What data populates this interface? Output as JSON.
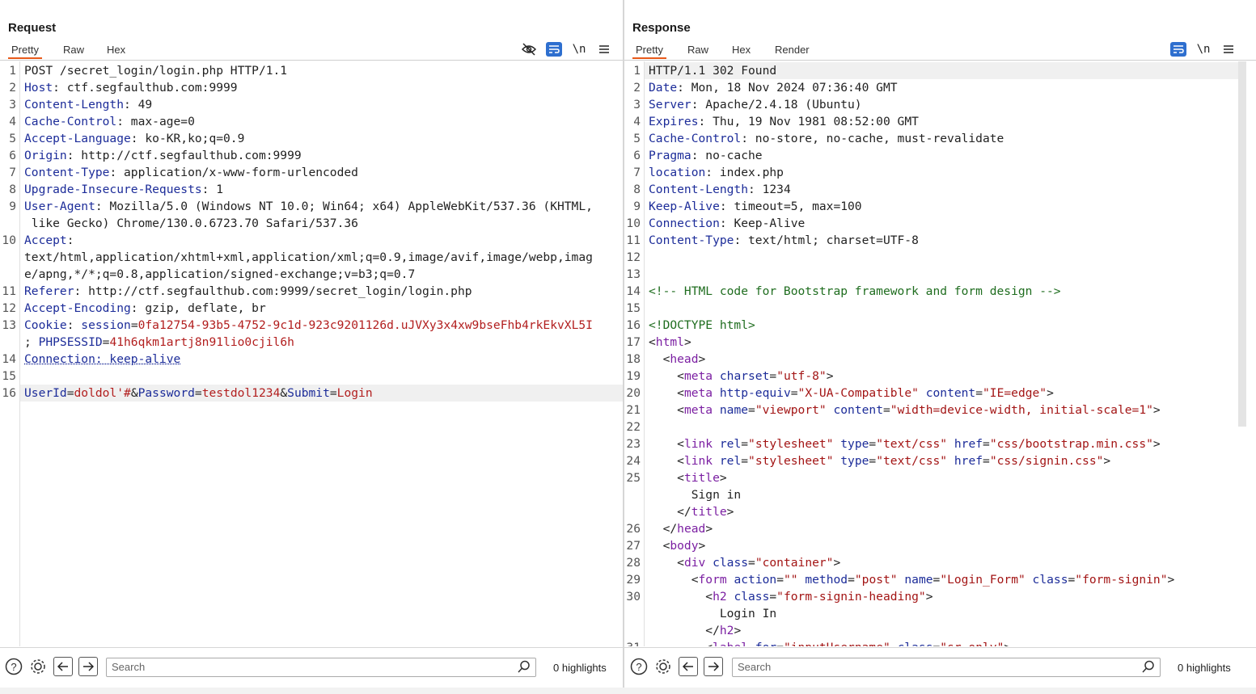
{
  "request": {
    "title": "Request",
    "tabs": [
      "Pretty",
      "Raw",
      "Hex"
    ],
    "active_tab": "Pretty",
    "lines": [
      {
        "n": "1",
        "parts": [
          {
            "t": "POST /secret_login/login.php HTTP/1.1",
            "c": "v"
          }
        ]
      },
      {
        "n": "2",
        "parts": [
          {
            "t": "Host",
            "c": "k"
          },
          {
            "t": ": ctf.segfaulthub.com:9999",
            "c": "v"
          }
        ]
      },
      {
        "n": "3",
        "parts": [
          {
            "t": "Content-Length",
            "c": "k"
          },
          {
            "t": ": 49",
            "c": "v"
          }
        ]
      },
      {
        "n": "4",
        "parts": [
          {
            "t": "Cache-Control",
            "c": "k"
          },
          {
            "t": ": max-age=0",
            "c": "v"
          }
        ]
      },
      {
        "n": "5",
        "parts": [
          {
            "t": "Accept-Language",
            "c": "k"
          },
          {
            "t": ": ko-KR,ko;q=0.9",
            "c": "v"
          }
        ]
      },
      {
        "n": "6",
        "parts": [
          {
            "t": "Origin",
            "c": "k"
          },
          {
            "t": ": http://ctf.segfaulthub.com:9999",
            "c": "v"
          }
        ]
      },
      {
        "n": "7",
        "parts": [
          {
            "t": "Content-Type",
            "c": "k"
          },
          {
            "t": ": application/x-www-form-urlencoded",
            "c": "v"
          }
        ]
      },
      {
        "n": "8",
        "parts": [
          {
            "t": "Upgrade-Insecure-Requests",
            "c": "k"
          },
          {
            "t": ": 1",
            "c": "v"
          }
        ]
      },
      {
        "n": "9",
        "parts": [
          {
            "t": "User-Agent",
            "c": "k"
          },
          {
            "t": ": Mozilla/5.0 (Windows NT 10.0; Win64; x64) AppleWebKit/537.36 (KHTML,",
            "c": "v"
          }
        ]
      },
      {
        "n": "",
        "parts": [
          {
            "t": " like Gecko) Chrome/130.0.6723.70 Safari/537.36",
            "c": "v"
          }
        ]
      },
      {
        "n": "10",
        "parts": [
          {
            "t": "Accept",
            "c": "k"
          },
          {
            "t": ":",
            "c": "v"
          }
        ]
      },
      {
        "n": "",
        "parts": [
          {
            "t": "text/html,application/xhtml+xml,application/xml;q=0.9,image/avif,image/webp,imag",
            "c": "v"
          }
        ]
      },
      {
        "n": "",
        "parts": [
          {
            "t": "e/apng,*/*;q=0.8,application/signed-exchange;v=b3;q=0.7",
            "c": "v"
          }
        ]
      },
      {
        "n": "11",
        "parts": [
          {
            "t": "Referer",
            "c": "k"
          },
          {
            "t": ": http://ctf.segfaulthub.com:9999/secret_login/login.php",
            "c": "v"
          }
        ]
      },
      {
        "n": "12",
        "parts": [
          {
            "t": "Accept-Encoding",
            "c": "k"
          },
          {
            "t": ": gzip, deflate, br",
            "c": "v"
          }
        ]
      },
      {
        "n": "13",
        "parts": [
          {
            "t": "Cookie",
            "c": "k"
          },
          {
            "t": ": ",
            "c": "v"
          },
          {
            "t": "session",
            "c": "k"
          },
          {
            "t": "=",
            "c": "v"
          },
          {
            "t": "0fa12754-93b5-4752-9c1d-923c9201126d.uJVXy3x4xw9bseFhb4rkEkvXL5I",
            "c": "r"
          }
        ]
      },
      {
        "n": "",
        "parts": [
          {
            "t": "; ",
            "c": "v"
          },
          {
            "t": "PHPSESSID",
            "c": "k"
          },
          {
            "t": "=",
            "c": "v"
          },
          {
            "t": "41h6qkm1artj8n91lio0cjil6h",
            "c": "r"
          }
        ]
      },
      {
        "n": "14",
        "parts": [
          {
            "t": "Connection: keep-alive",
            "c": "k dl"
          }
        ]
      },
      {
        "n": "15",
        "parts": []
      },
      {
        "n": "16",
        "highlight": true,
        "parts": [
          {
            "t": "UserId",
            "c": "k"
          },
          {
            "t": "=",
            "c": "v"
          },
          {
            "t": "doldol'#",
            "c": "r"
          },
          {
            "t": "&",
            "c": "v"
          },
          {
            "t": "Password",
            "c": "k"
          },
          {
            "t": "=",
            "c": "v"
          },
          {
            "t": "testdol1234",
            "c": "r"
          },
          {
            "t": "&",
            "c": "v"
          },
          {
            "t": "Submit",
            "c": "k"
          },
          {
            "t": "=",
            "c": "v"
          },
          {
            "t": "Login",
            "c": "r"
          }
        ]
      }
    ],
    "search_placeholder": "Search",
    "highlights": "0 highlights"
  },
  "response": {
    "title": "Response",
    "tabs": [
      "Pretty",
      "Raw",
      "Hex",
      "Render"
    ],
    "active_tab": "Pretty",
    "lines": [
      {
        "n": "1",
        "highlight": true,
        "parts": [
          {
            "t": "HTTP/1.1 302 Found",
            "c": "v"
          }
        ]
      },
      {
        "n": "2",
        "parts": [
          {
            "t": "Date",
            "c": "k"
          },
          {
            "t": ": Mon, 18 Nov 2024 07:36:40 GMT",
            "c": "v"
          }
        ]
      },
      {
        "n": "3",
        "parts": [
          {
            "t": "Server",
            "c": "k"
          },
          {
            "t": ": Apache/2.4.18 (Ubuntu)",
            "c": "v"
          }
        ]
      },
      {
        "n": "4",
        "parts": [
          {
            "t": "Expires",
            "c": "k"
          },
          {
            "t": ": Thu, 19 Nov 1981 08:52:00 GMT",
            "c": "v"
          }
        ]
      },
      {
        "n": "5",
        "parts": [
          {
            "t": "Cache-Control",
            "c": "k"
          },
          {
            "t": ": no-store, no-cache, must-revalidate",
            "c": "v"
          }
        ]
      },
      {
        "n": "6",
        "parts": [
          {
            "t": "Pragma",
            "c": "k"
          },
          {
            "t": ": no-cache",
            "c": "v"
          }
        ]
      },
      {
        "n": "7",
        "parts": [
          {
            "t": "location",
            "c": "k"
          },
          {
            "t": ": index.php",
            "c": "v"
          }
        ]
      },
      {
        "n": "8",
        "parts": [
          {
            "t": "Content-Length",
            "c": "k"
          },
          {
            "t": ": 1234",
            "c": "v"
          }
        ]
      },
      {
        "n": "9",
        "parts": [
          {
            "t": "Keep-Alive",
            "c": "k"
          },
          {
            "t": ": timeout=5, max=100",
            "c": "v"
          }
        ]
      },
      {
        "n": "10",
        "parts": [
          {
            "t": "Connection",
            "c": "k"
          },
          {
            "t": ": Keep-Alive",
            "c": "v"
          }
        ]
      },
      {
        "n": "11",
        "parts": [
          {
            "t": "Content-Type",
            "c": "k"
          },
          {
            "t": ": text/html; charset=UTF-8",
            "c": "v"
          }
        ]
      },
      {
        "n": "12",
        "parts": []
      },
      {
        "n": "13",
        "parts": []
      },
      {
        "n": "14",
        "parts": [
          {
            "t": "<!-- HTML code for Bootstrap framework and form design -->",
            "c": "pr"
          }
        ]
      },
      {
        "n": "15",
        "parts": []
      },
      {
        "n": "16",
        "parts": [
          {
            "t": "<!DOCTYPE html>",
            "c": "pr"
          }
        ]
      },
      {
        "n": "17",
        "parts": [
          {
            "t": "<",
            "c": "v"
          },
          {
            "t": "html",
            "c": "tg"
          },
          {
            "t": ">",
            "c": "v"
          }
        ]
      },
      {
        "n": "18",
        "parts": [
          {
            "t": "  <",
            "c": "v"
          },
          {
            "t": "head",
            "c": "tg"
          },
          {
            "t": ">",
            "c": "v"
          }
        ]
      },
      {
        "n": "19",
        "parts": [
          {
            "t": "    <",
            "c": "v"
          },
          {
            "t": "meta",
            "c": "tg"
          },
          {
            "t": " charset",
            "c": "at"
          },
          {
            "t": "=",
            "c": "v"
          },
          {
            "t": "\"utf-8\"",
            "c": "st"
          },
          {
            "t": ">",
            "c": "v"
          }
        ]
      },
      {
        "n": "20",
        "parts": [
          {
            "t": "    <",
            "c": "v"
          },
          {
            "t": "meta",
            "c": "tg"
          },
          {
            "t": " http-equiv",
            "c": "at"
          },
          {
            "t": "=",
            "c": "v"
          },
          {
            "t": "\"X-UA-Compatible\"",
            "c": "st"
          },
          {
            "t": " content",
            "c": "at"
          },
          {
            "t": "=",
            "c": "v"
          },
          {
            "t": "\"IE=edge\"",
            "c": "st"
          },
          {
            "t": ">",
            "c": "v"
          }
        ]
      },
      {
        "n": "21",
        "parts": [
          {
            "t": "    <",
            "c": "v"
          },
          {
            "t": "meta",
            "c": "tg"
          },
          {
            "t": " name",
            "c": "at"
          },
          {
            "t": "=",
            "c": "v"
          },
          {
            "t": "\"viewport\"",
            "c": "st"
          },
          {
            "t": " content",
            "c": "at"
          },
          {
            "t": "=",
            "c": "v"
          },
          {
            "t": "\"width=device-width, initial-scale=1\"",
            "c": "st"
          },
          {
            "t": ">",
            "c": "v"
          }
        ]
      },
      {
        "n": "22",
        "parts": []
      },
      {
        "n": "23",
        "parts": [
          {
            "t": "    <",
            "c": "v"
          },
          {
            "t": "link",
            "c": "tg"
          },
          {
            "t": " rel",
            "c": "at"
          },
          {
            "t": "=",
            "c": "v"
          },
          {
            "t": "\"stylesheet\"",
            "c": "st"
          },
          {
            "t": " type",
            "c": "at"
          },
          {
            "t": "=",
            "c": "v"
          },
          {
            "t": "\"text/css\"",
            "c": "st"
          },
          {
            "t": " href",
            "c": "at"
          },
          {
            "t": "=",
            "c": "v"
          },
          {
            "t": "\"css/bootstrap.min.css\"",
            "c": "st"
          },
          {
            "t": ">",
            "c": "v"
          }
        ]
      },
      {
        "n": "24",
        "parts": [
          {
            "t": "    <",
            "c": "v"
          },
          {
            "t": "link",
            "c": "tg"
          },
          {
            "t": " rel",
            "c": "at"
          },
          {
            "t": "=",
            "c": "v"
          },
          {
            "t": "\"stylesheet\"",
            "c": "st"
          },
          {
            "t": " type",
            "c": "at"
          },
          {
            "t": "=",
            "c": "v"
          },
          {
            "t": "\"text/css\"",
            "c": "st"
          },
          {
            "t": " href",
            "c": "at"
          },
          {
            "t": "=",
            "c": "v"
          },
          {
            "t": "\"css/signin.css\"",
            "c": "st"
          },
          {
            "t": ">",
            "c": "v"
          }
        ]
      },
      {
        "n": "25",
        "parts": [
          {
            "t": "    <",
            "c": "v"
          },
          {
            "t": "title",
            "c": "tg"
          },
          {
            "t": ">",
            "c": "v"
          }
        ]
      },
      {
        "n": "",
        "parts": [
          {
            "t": "      Sign in",
            "c": "v"
          }
        ]
      },
      {
        "n": "",
        "parts": [
          {
            "t": "    </",
            "c": "v"
          },
          {
            "t": "title",
            "c": "tg"
          },
          {
            "t": ">",
            "c": "v"
          }
        ]
      },
      {
        "n": "26",
        "parts": [
          {
            "t": "  </",
            "c": "v"
          },
          {
            "t": "head",
            "c": "tg"
          },
          {
            "t": ">",
            "c": "v"
          }
        ]
      },
      {
        "n": "27",
        "parts": [
          {
            "t": "  <",
            "c": "v"
          },
          {
            "t": "body",
            "c": "tg"
          },
          {
            "t": ">",
            "c": "v"
          }
        ]
      },
      {
        "n": "28",
        "parts": [
          {
            "t": "    <",
            "c": "v"
          },
          {
            "t": "div",
            "c": "tg"
          },
          {
            "t": " class",
            "c": "at"
          },
          {
            "t": "=",
            "c": "v"
          },
          {
            "t": "\"container\"",
            "c": "st"
          },
          {
            "t": ">",
            "c": "v"
          }
        ]
      },
      {
        "n": "29",
        "parts": [
          {
            "t": "      <",
            "c": "v"
          },
          {
            "t": "form",
            "c": "tg"
          },
          {
            "t": " action",
            "c": "at"
          },
          {
            "t": "=",
            "c": "v"
          },
          {
            "t": "\"\"",
            "c": "st"
          },
          {
            "t": " method",
            "c": "at"
          },
          {
            "t": "=",
            "c": "v"
          },
          {
            "t": "\"post\"",
            "c": "st"
          },
          {
            "t": " name",
            "c": "at"
          },
          {
            "t": "=",
            "c": "v"
          },
          {
            "t": "\"Login_Form\"",
            "c": "st"
          },
          {
            "t": " class",
            "c": "at"
          },
          {
            "t": "=",
            "c": "v"
          },
          {
            "t": "\"form-signin\"",
            "c": "st"
          },
          {
            "t": ">",
            "c": "v"
          }
        ]
      },
      {
        "n": "30",
        "parts": [
          {
            "t": "        <",
            "c": "v"
          },
          {
            "t": "h2",
            "c": "tg"
          },
          {
            "t": " class",
            "c": "at"
          },
          {
            "t": "=",
            "c": "v"
          },
          {
            "t": "\"form-signin-heading\"",
            "c": "st"
          },
          {
            "t": ">",
            "c": "v"
          }
        ]
      },
      {
        "n": "",
        "parts": [
          {
            "t": "          Login In",
            "c": "v"
          }
        ]
      },
      {
        "n": "",
        "parts": [
          {
            "t": "        </",
            "c": "v"
          },
          {
            "t": "h2",
            "c": "tg"
          },
          {
            "t": ">",
            "c": "v"
          }
        ]
      },
      {
        "n": "31",
        "parts": [
          {
            "t": "        <",
            "c": "v"
          },
          {
            "t": "label",
            "c": "tg"
          },
          {
            "t": " for",
            "c": "at"
          },
          {
            "t": "=",
            "c": "v"
          },
          {
            "t": "\"inputUsername\"",
            "c": "st"
          },
          {
            "t": " class",
            "c": "at"
          },
          {
            "t": "=",
            "c": "v"
          },
          {
            "t": "\"sr-only\"",
            "c": "st"
          },
          {
            "t": ">",
            "c": "v"
          }
        ]
      }
    ],
    "search_placeholder": "Search",
    "highlights": "0 highlights"
  },
  "icons": {
    "hide": "eye-off-icon",
    "wrap": "word-wrap-icon",
    "newline": "\\n",
    "menu": "hamburger-menu-icon",
    "help": "help-icon",
    "settings": "gear-icon",
    "back": "arrow-left-icon",
    "forward": "arrow-right-icon",
    "search": "search-icon"
  },
  "colors": {
    "accent_tab": "#e8591a",
    "button_blue": "#2e6fcf",
    "key": "#1c2c99",
    "value_red": "#b21e1e",
    "tag_purple": "#7b1fa2",
    "comment_green": "#1f6d1f"
  }
}
